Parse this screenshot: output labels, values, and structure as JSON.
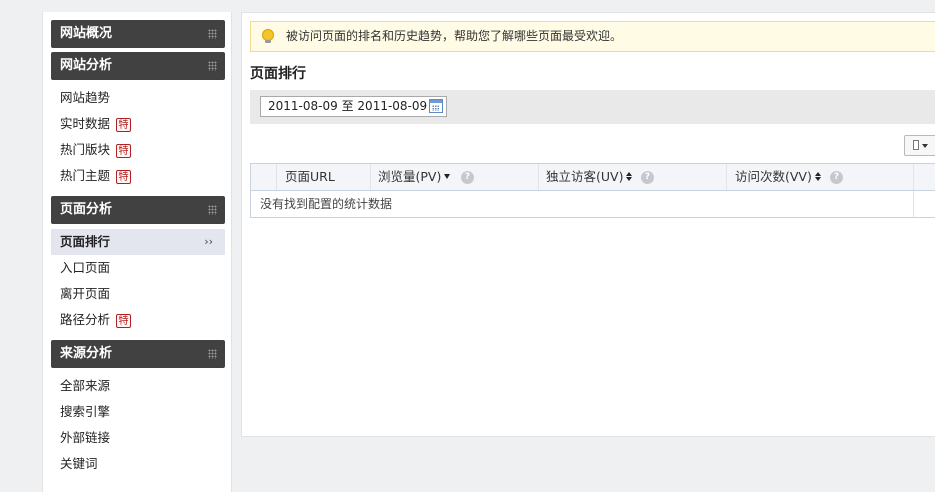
{
  "sidebar": {
    "sections": [
      {
        "title": "网站概况",
        "items": []
      },
      {
        "title": "网站分析",
        "items": [
          {
            "label": "网站趋势",
            "badge": ""
          },
          {
            "label": "实时数据",
            "badge": "特"
          },
          {
            "label": "热门版块",
            "badge": "特"
          },
          {
            "label": "热门主题",
            "badge": "特"
          }
        ]
      },
      {
        "title": "页面分析",
        "items": [
          {
            "label": "页面排行",
            "badge": "",
            "active": true,
            "arrow": "››"
          },
          {
            "label": "入口页面",
            "badge": ""
          },
          {
            "label": "离开页面",
            "badge": ""
          },
          {
            "label": "路径分析",
            "badge": "特"
          }
        ]
      },
      {
        "title": "来源分析",
        "items": [
          {
            "label": "全部来源",
            "badge": ""
          },
          {
            "label": "搜索引擎",
            "badge": ""
          },
          {
            "label": "外部链接",
            "badge": ""
          },
          {
            "label": "关键词",
            "badge": ""
          }
        ]
      }
    ]
  },
  "main": {
    "tip": "被访问页面的排名和历史趋势，帮助您了解哪些页面最受欢迎。",
    "title": "页面排行",
    "date": {
      "from": "2011-08-09",
      "sep": "至",
      "to": "2011-08-09"
    },
    "table": {
      "columns": [
        {
          "label": "页面URL",
          "sort": ""
        },
        {
          "label": "浏览量(PV)",
          "sort": "desc",
          "help": "?"
        },
        {
          "label": "独立访客(UV)",
          "sort": "both",
          "help": "?"
        },
        {
          "label": "访问次数(VV)",
          "sort": "both",
          "help": "?"
        }
      ],
      "empty_text": "没有找到配置的统计数据"
    }
  }
}
